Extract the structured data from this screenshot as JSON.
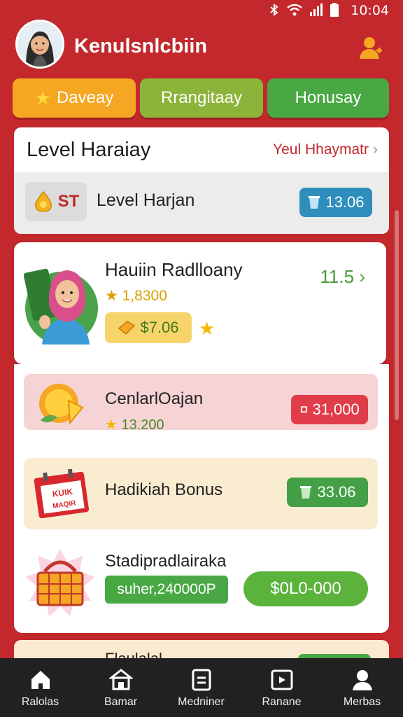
{
  "status_bar": {
    "time": "10:04",
    "icons": [
      "bluetooth-icon",
      "wifi-icon",
      "signal-icon",
      "battery-icon"
    ]
  },
  "header": {
    "username": "Kenulsnlcbiin",
    "profile_icon": "user-icon"
  },
  "tabs": [
    {
      "label": "Daveay",
      "icon": "star-icon"
    },
    {
      "label": "Rrangitaay"
    },
    {
      "label": "Honusay"
    }
  ],
  "level_card": {
    "title": "Level Haraiay",
    "link": "Yeul Hhaymatr",
    "sub_label": "Level Harjan",
    "sub_icon_text": "ST",
    "sub_value": "13.06"
  },
  "featured": {
    "name": "Hauiin Radlloany",
    "points": "1,8300",
    "price": "$7.06",
    "score": "11.5"
  },
  "items": [
    {
      "name": "CenlarlOajan",
      "points": "13.200",
      "value": "31,000",
      "value_prefix": "¤"
    },
    {
      "name": "Hadikiah Bonus",
      "value": "33.06",
      "ill_text_1": "KUIK",
      "ill_text_2": "MAQIR"
    },
    {
      "name": "Stadipradlairaka",
      "pill": "suher,240000P",
      "button": "$0L0-000"
    }
  ],
  "peek_item": {
    "name": "Flaulalal"
  },
  "bottom_nav": [
    {
      "label": "Ralolas",
      "icon": "home-icon"
    },
    {
      "label": "Bamar",
      "icon": "store-icon"
    },
    {
      "label": "Medniner",
      "icon": "document-icon"
    },
    {
      "label": "Ranane",
      "icon": "image-icon"
    },
    {
      "label": "Merbas",
      "icon": "profile-icon"
    }
  ],
  "colors": {
    "background": "#c2282c",
    "accent_green": "#49a844",
    "accent_orange": "#f5a623",
    "nav_bg": "#212121"
  }
}
